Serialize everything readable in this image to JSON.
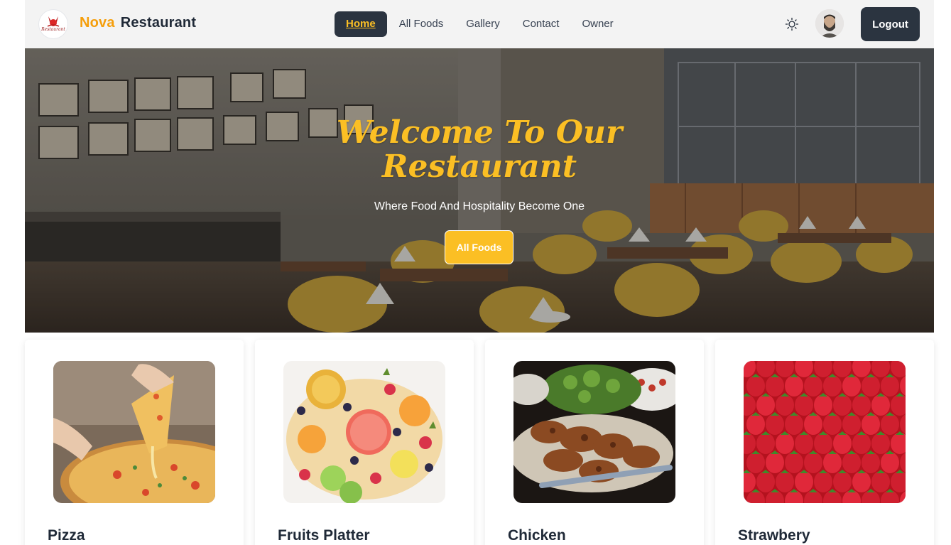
{
  "brand": {
    "part1": "Nova",
    "part2": "Restaurant",
    "logo_icon": "restaurant-logo-icon",
    "logo_text": "Restaurant"
  },
  "nav": {
    "links": [
      "Home",
      "All Foods",
      "Gallery",
      "Contact",
      "Owner"
    ],
    "active": "Home",
    "theme_icon": "sun-icon",
    "avatar_icon": "user-avatar",
    "logout": "Logout"
  },
  "hero": {
    "title_line1": "Welcome To Our",
    "title_line2": "Restaurant",
    "subtitle": "Where Food And Hospitality Become One",
    "button": "All Foods"
  },
  "foods": [
    {
      "name": "Pizza"
    },
    {
      "name": "Fruits Platter"
    },
    {
      "name": "Chicken"
    },
    {
      "name": "Strawbery"
    }
  ],
  "colors": {
    "accent": "#fbbf24",
    "brand_orange": "#f59e0b",
    "dark": "#2b3440",
    "navbar_bg": "#f3f3f3"
  }
}
